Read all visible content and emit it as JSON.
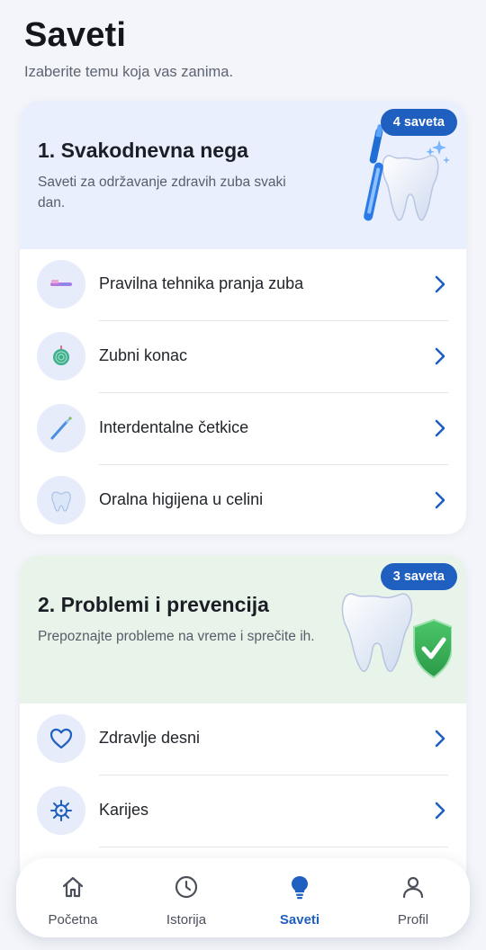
{
  "header": {
    "title": "Saveti",
    "subtitle": "Izaberite temu koja vas zanima."
  },
  "sections": [
    {
      "title": "1. Svakodnevna nega",
      "description": "Saveti za održavanje zdravih zuba svaki dan.",
      "badge": "4 saveta",
      "items": [
        {
          "label": "Pravilna tehnika pranja zuba",
          "icon": "toothbrush-icon"
        },
        {
          "label": "Zubni konac",
          "icon": "floss-icon"
        },
        {
          "label": "Interdentalne četkice",
          "icon": "interdental-brush-icon"
        },
        {
          "label": "Oralna higijena u celini",
          "icon": "tooth-icon"
        }
      ]
    },
    {
      "title": "2. Problemi i prevencija",
      "description": "Prepoznajte probleme na vreme i sprečite ih.",
      "badge": "3 saveta",
      "items": [
        {
          "label": "Zdravlje desni",
          "icon": "heart-icon"
        },
        {
          "label": "Karijes",
          "icon": "bacteria-icon"
        }
      ]
    }
  ],
  "nav": {
    "items": [
      {
        "label": "Početna",
        "icon": "home-icon"
      },
      {
        "label": "Istorija",
        "icon": "clock-icon"
      },
      {
        "label": "Saveti",
        "icon": "lightbulb-icon",
        "active": true
      },
      {
        "label": "Profil",
        "icon": "user-icon"
      }
    ]
  },
  "colors": {
    "accent": "#1f5fbf",
    "card1_header": "#e9effc",
    "card2_header": "#e8f3ea",
    "icon_bg": "#e7ecfa"
  }
}
